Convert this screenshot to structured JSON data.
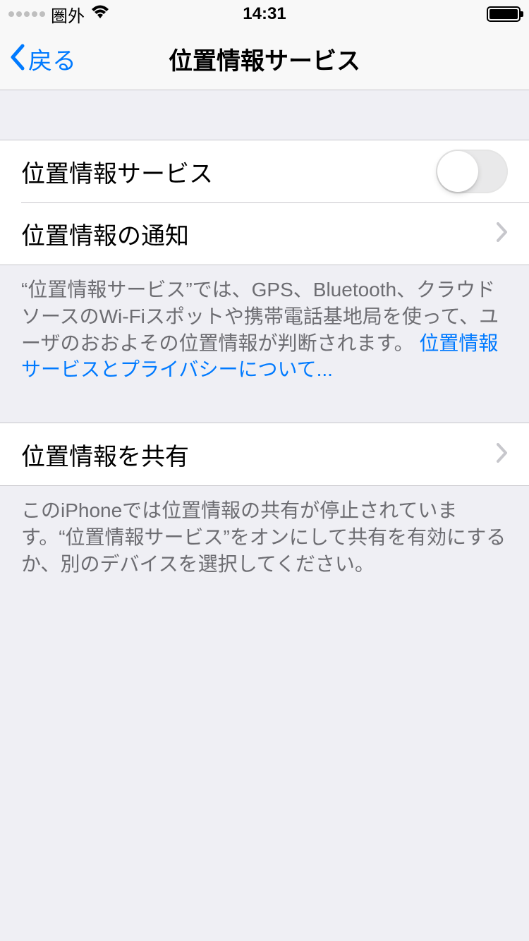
{
  "statusBar": {
    "carrier": "圏外",
    "time": "14:31"
  },
  "nav": {
    "backLabel": "戻る",
    "title": "位置情報サービス"
  },
  "cells": {
    "locationServices": "位置情報サービス",
    "locationAlerts": "位置情報の通知",
    "shareLocation": "位置情報を共有"
  },
  "footers": {
    "group1_text": "“位置情報サービス”では、GPS、Bluetooth、クラウドソースのWi-Fiスポットや携帯電話基地局を使って、ユーザのおおよその位置情報が判断されます。 ",
    "group1_link": "位置情報サービスとプライバシーについて...",
    "group2_text": "このiPhoneでは位置情報の共有が停止されています。“位置情報サービス”をオンにして共有を有効にするか、別のデバイスを選択してください。"
  },
  "toggles": {
    "locationServicesOn": false
  }
}
